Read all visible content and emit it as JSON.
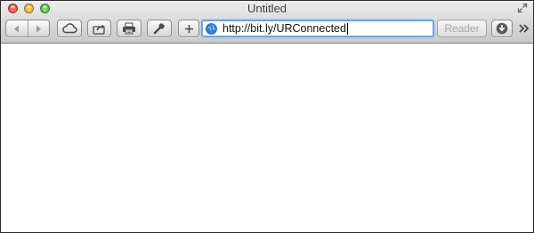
{
  "window": {
    "title": "Untitled"
  },
  "toolbar": {
    "address": {
      "url": "http://bit.ly/URConnected"
    },
    "reader_label": "Reader",
    "icons": {
      "back": "back-icon",
      "forward": "forward-icon",
      "icloud": "cloud-icon",
      "share": "share-icon",
      "print": "print-icon",
      "settings": "wrench-icon",
      "add": "plus-icon",
      "downloads": "download-icon",
      "overflow": "chevron-double-right-icon"
    }
  },
  "colors": {
    "close": "#e0443e",
    "minimize": "#e4a02f",
    "zoom": "#5cb445",
    "address_focus": "#6ea6e3"
  }
}
